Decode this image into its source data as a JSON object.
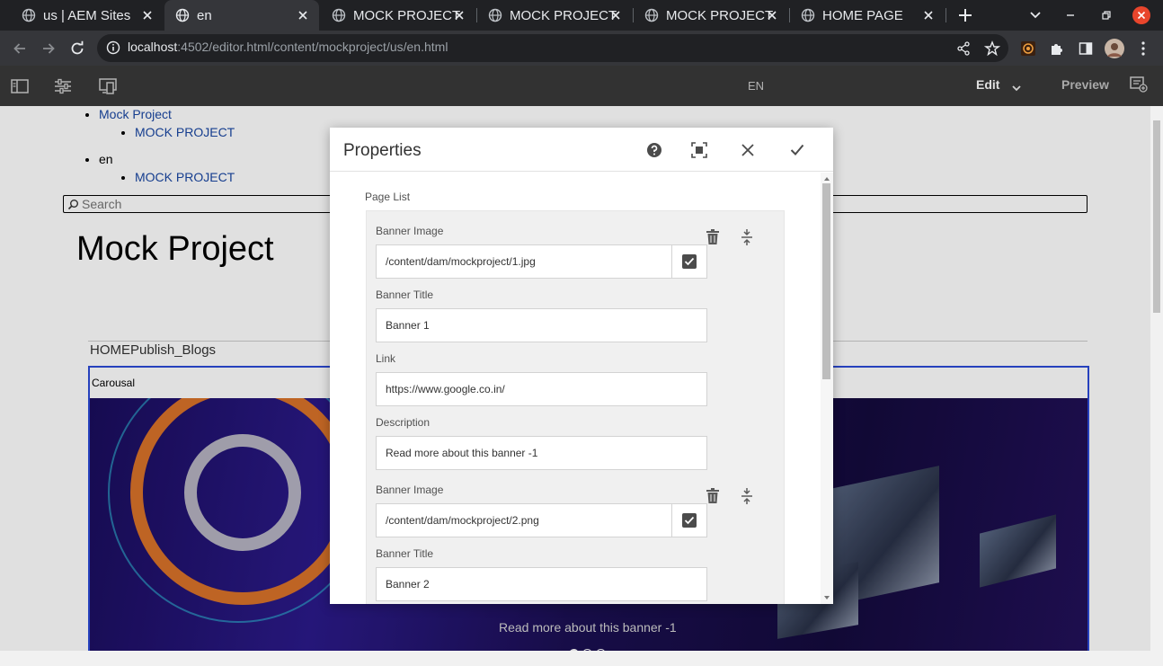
{
  "browser": {
    "tabs": [
      {
        "label": "us | AEM Sites",
        "active": false
      },
      {
        "label": "en",
        "active": true
      },
      {
        "label": "MOCK PROJECT",
        "active": false
      },
      {
        "label": "MOCK PROJECT",
        "active": false
      },
      {
        "label": "MOCK PROJECT",
        "active": false
      },
      {
        "label": "HOME PAGE",
        "active": false
      }
    ],
    "url_host": "localhost",
    "url_rest": ":4502/editor.html/content/mockproject/us/en.html"
  },
  "aem": {
    "page_title": "EN",
    "mode_label": "Edit",
    "preview_label": "Preview"
  },
  "page": {
    "nav": {
      "item1": "Mock Project",
      "item1_sub": "MOCK PROJECT",
      "item2": "en",
      "item2_sub": "MOCK PROJECT"
    },
    "search_placeholder": "Search",
    "title": "Mock Project",
    "home_links": "HOMEPublish_Blogs",
    "carousel_label": "Carousal",
    "carousel_caption": "Read more about this banner -1",
    "carousel_dots": 3,
    "carousel_active_dot": 1
  },
  "dialog": {
    "title": "Properties",
    "fieldset_label": "Page List",
    "items": [
      {
        "image_label": "Banner Image",
        "image_value": "/content/dam/mockproject/1.jpg",
        "title_label": "Banner Title",
        "title_value": "Banner 1",
        "link_label": "Link",
        "link_value": "https://www.google.co.in/",
        "desc_label": "Description",
        "desc_value": "Read more about this banner -1"
      },
      {
        "image_label": "Banner Image",
        "image_value": "/content/dam/mockproject/2.png",
        "title_label": "Banner Title",
        "title_value": "Banner 2"
      }
    ]
  },
  "colors": {
    "browser_bg": "#202124",
    "tab_active_bg": "#35363a",
    "aem_toolbar_bg": "#323232",
    "link_blue": "#1a47a3",
    "carousel_border": "#2c4bd8",
    "close_red": "#e8452c"
  }
}
